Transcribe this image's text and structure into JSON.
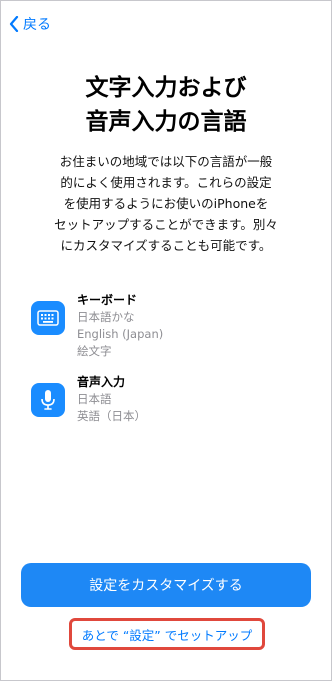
{
  "nav": {
    "back_label": "戻る"
  },
  "header": {
    "title_line1": "文字入力および",
    "title_line2": "音声入力の言語"
  },
  "description": {
    "lines": [
      "お住まいの地域では以下の言語が一般",
      "的によく使用されます。これらの設定",
      "を使用するようにお使いのiPhoneを",
      "セットアップすることができます。別々",
      "にカスタマイズすることも可能です。"
    ]
  },
  "keyboard": {
    "title": "キーボード",
    "items": [
      "日本語かな",
      "English (Japan)",
      "絵文字"
    ],
    "icon": "keyboard-icon"
  },
  "dictation": {
    "title": "音声入力",
    "items": [
      "日本語",
      "英語（日本）"
    ],
    "icon": "microphone-icon"
  },
  "actions": {
    "customize_label": "設定をカスタマイズする",
    "later_label": "あとで “設定” でセットアップ"
  },
  "colors": {
    "accent": "#007aff",
    "button": "#1e88f5",
    "highlight": "#e0483c"
  }
}
